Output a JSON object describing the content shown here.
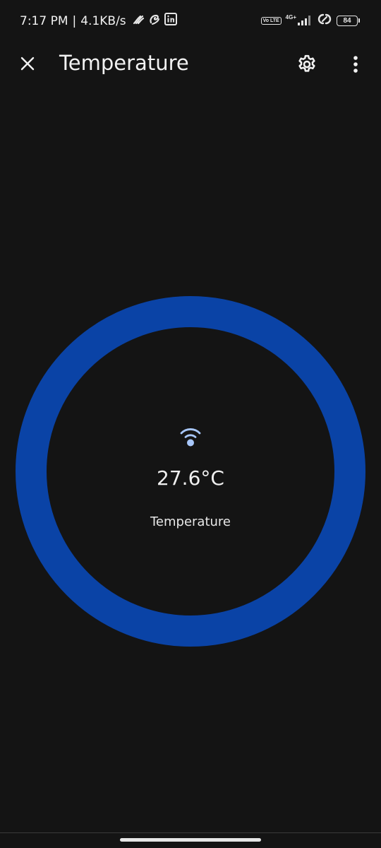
{
  "status_bar": {
    "time": "7:17 PM",
    "separator": "|",
    "network_speed": "4.1KB/s",
    "volte_label": "Vo LTE",
    "network_type": "4G+",
    "battery_level": "84",
    "left_icons": [
      "airtel-icon",
      "swirl-icon",
      "linkedin-icon"
    ],
    "right_icons": [
      "volte-icon",
      "signal-icon",
      "hotspot-icon",
      "battery-icon"
    ]
  },
  "app_bar": {
    "title": "Temperature",
    "close_icon": "close-icon",
    "settings_icon": "gear-icon",
    "more_icon": "more-vert-icon"
  },
  "gauge": {
    "value": "27.6°C",
    "label": "Temperature",
    "sensor_icon": "sensor-signal-icon",
    "ring_color": "#0a43a6",
    "icon_color": "#a8c7fa"
  },
  "colors": {
    "background": "#141414",
    "text": "#f2f2f2",
    "accent": "#0a43a6"
  }
}
